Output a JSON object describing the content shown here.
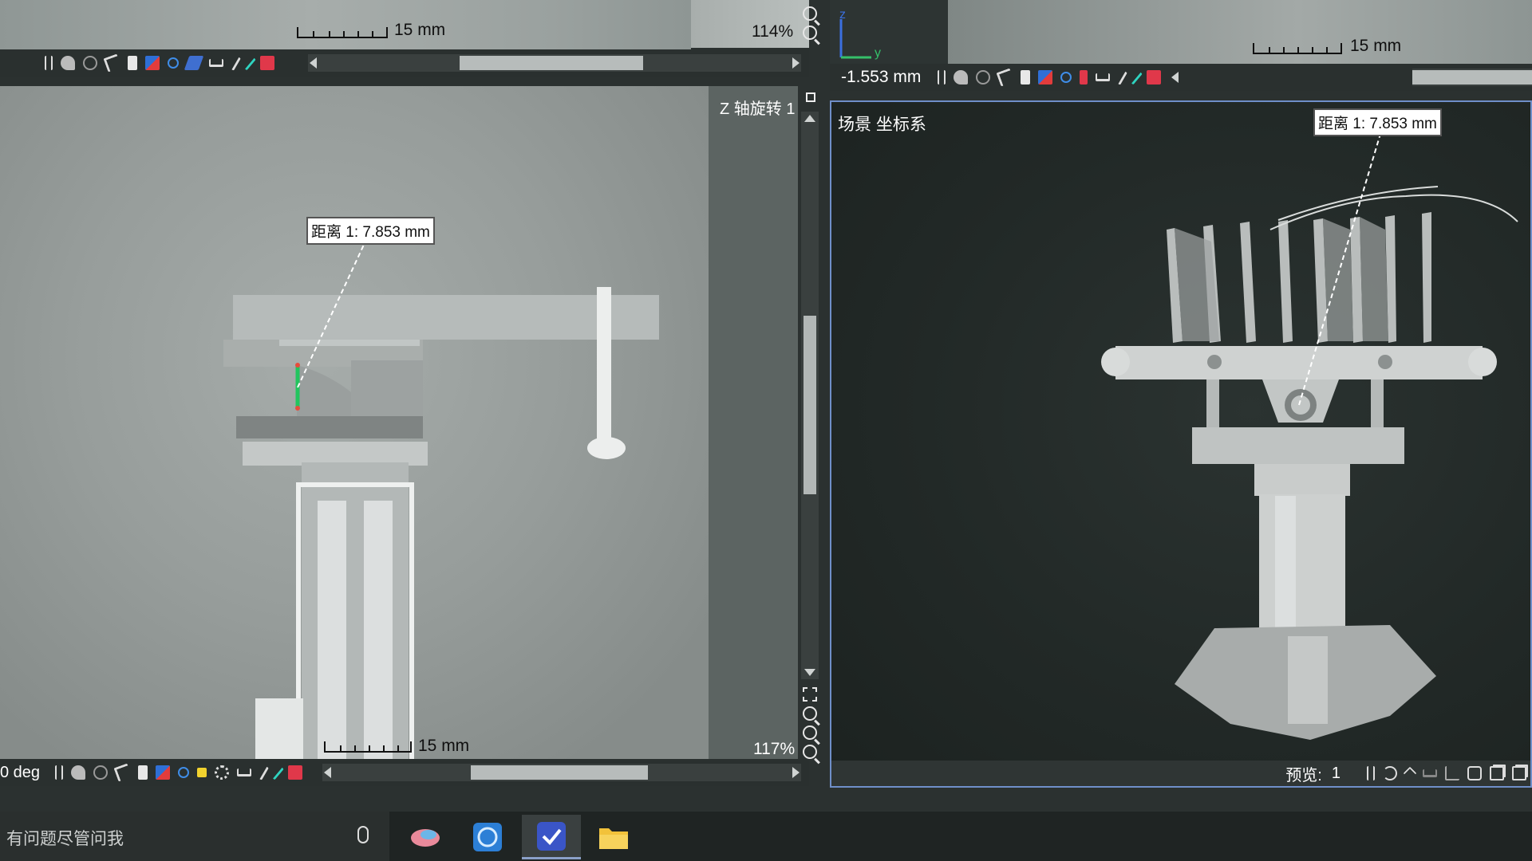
{
  "top_left": {
    "scale_label": "15 mm",
    "zoom": "114%"
  },
  "left_panel": {
    "title": "Z 轴旋转 1",
    "measurement": "距离 1: 7.853 mm",
    "scale_label": "15 mm",
    "zoom": "117%",
    "angle": "0 deg"
  },
  "right_panel": {
    "offset": "-1.553 mm",
    "scale_label": "15 mm",
    "title": "场景 坐标系",
    "measurement": "距离 1: 7.853 mm",
    "preview_label": "预览:",
    "preview_value": "1",
    "axis_y": "y",
    "axis_z": "z"
  },
  "taskbar": {
    "search_placeholder": "有问题尽管问我",
    "apps": [
      "bird-app-icon",
      "blue-app-icon",
      "shield-app-icon",
      "folder-icon"
    ]
  },
  "colors": {
    "selection_border": "#6f8fc9",
    "cut_green": "#22c55e",
    "cut_red": "#e74c3c"
  }
}
